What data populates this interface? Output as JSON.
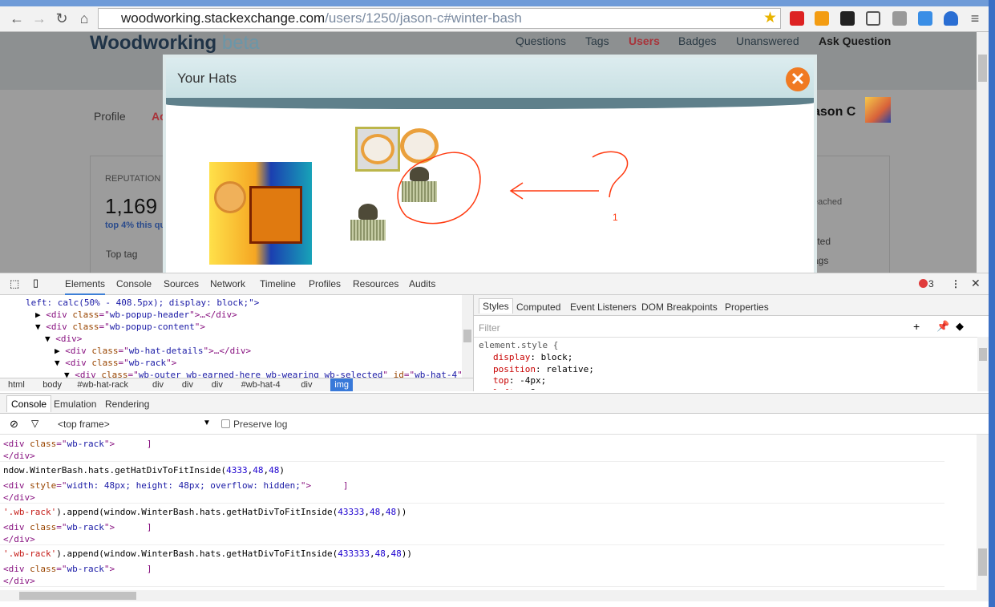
{
  "browser": {
    "url_host": "woodworking.stackexchange.com",
    "url_path": "/users/1250/jason-c#winter-bash"
  },
  "site": {
    "name": "Woodworking",
    "beta": "beta",
    "nav": [
      "Questions",
      "Tags",
      "Users",
      "Badges",
      "Unanswered",
      "Ask Question"
    ],
    "active_nav": "Users",
    "accent": "#c0392b"
  },
  "profile": {
    "tabs": [
      "Profile",
      "Ac"
    ],
    "username": "ason C",
    "reputation_label": "REPUTATION",
    "reputation": "1,169",
    "rank": "top 4% this qu",
    "top_tag": "Top tag",
    "side": [
      "eached",
      "lited",
      "ags"
    ]
  },
  "modal": {
    "title": "Your Hats",
    "close": "✕",
    "annotation_mark": "1"
  },
  "devtools": {
    "tabs": [
      "Elements",
      "Console",
      "Sources",
      "Network",
      "Timeline",
      "Profiles",
      "Resources",
      "Audits"
    ],
    "error_count": "3",
    "elements": [
      [
        [
          "left: calc(50% - 408.5px); display: block;\">",
          "val"
        ]
      ],
      [
        [
          "▶ ",
          "x"
        ],
        [
          "<div ",
          "tag"
        ],
        [
          "class",
          "attr"
        ],
        [
          "=\"",
          "tag"
        ],
        [
          "wb-popup-header",
          "val"
        ],
        [
          "\">…</div>",
          "tag"
        ]
      ],
      [
        [
          "▼ ",
          "x"
        ],
        [
          "<div ",
          "tag"
        ],
        [
          "class",
          "attr"
        ],
        [
          "=\"",
          "tag"
        ],
        [
          "wb-popup-content",
          "val"
        ],
        [
          "\">",
          "tag"
        ]
      ],
      [
        [
          "▼ ",
          "x"
        ],
        [
          "<div>",
          "tag"
        ]
      ],
      [
        [
          "▶ ",
          "x"
        ],
        [
          "<div ",
          "tag"
        ],
        [
          "class",
          "attr"
        ],
        [
          "=\"",
          "tag"
        ],
        [
          "wb-hat-details",
          "val"
        ],
        [
          "\">…</div>",
          "tag"
        ]
      ],
      [
        [
          "▼ ",
          "x"
        ],
        [
          "<div ",
          "tag"
        ],
        [
          "class",
          "attr"
        ],
        [
          "=\"",
          "tag"
        ],
        [
          "wb-rack",
          "val"
        ],
        [
          "\">",
          "tag"
        ]
      ],
      [
        [
          "▼ ",
          "x"
        ],
        [
          "<div ",
          "tag"
        ],
        [
          "class",
          "attr"
        ],
        [
          "=\"",
          "tag"
        ],
        [
          "wb-outer wb-earned-here wb-wearing wb-selected",
          "val"
        ],
        [
          "\" ",
          "tag"
        ],
        [
          "id",
          "attr"
        ],
        [
          "=\"",
          "tag"
        ],
        [
          "wb-hat-4",
          "val"
        ],
        [
          "\"",
          "tag"
        ]
      ]
    ],
    "breadcrumbs": [
      "html",
      "body",
      "#wb-hat-rack",
      "div",
      "div",
      "div",
      "#wb-hat-4",
      "div",
      "img"
    ],
    "styles_tabs": [
      "Styles",
      "Computed",
      "Event Listeners",
      "DOM Breakpoints",
      "Properties"
    ],
    "filter_placeholder": "Filter",
    "styles": {
      "selector": "element.style {",
      "rules": [
        [
          "display",
          "block;"
        ],
        [
          "position",
          "relative;"
        ],
        [
          "top",
          "-4px;"
        ],
        [
          "left",
          "-8px;"
        ]
      ]
    },
    "drawer_tabs": [
      "Console",
      "Emulation",
      "Rendering"
    ],
    "frame": "<top frame>",
    "preserve_log": "Preserve log",
    "console": [
      [
        [
          "<div ",
          "tag"
        ],
        [
          "class",
          "attr"
        ],
        [
          "=\"",
          "tag"
        ],
        [
          "wb-rack",
          "val"
        ],
        [
          "\">      ]",
          "tag"
        ]
      ],
      [
        [
          "</div>",
          "tag"
        ]
      ],
      [
        [
          "ndow.WinterBash.hats.getHatDivToFitInside(",
          "x"
        ],
        [
          "4333",
          "num"
        ],
        [
          ",",
          "x"
        ],
        [
          "48",
          "num"
        ],
        [
          ",",
          "x"
        ],
        [
          "48",
          "num"
        ],
        [
          ")",
          "x"
        ]
      ],
      [
        [
          "<div ",
          "tag"
        ],
        [
          "style",
          "attr"
        ],
        [
          "=\"",
          "tag"
        ],
        [
          "width: 48px; height: 48px; overflow: hidden;",
          "val"
        ],
        [
          "\">      ]",
          "tag"
        ]
      ],
      [
        [
          "</div>",
          "tag"
        ]
      ],
      [
        [
          "'.wb-rack'",
          "str"
        ],
        [
          ").append(window.WinterBash.hats.getHatDivToFitInside(",
          "x"
        ],
        [
          "43333",
          "num"
        ],
        [
          ",",
          "x"
        ],
        [
          "48",
          "num"
        ],
        [
          ",",
          "x"
        ],
        [
          "48",
          "num"
        ],
        [
          "))",
          "x"
        ]
      ],
      [
        [
          "<div ",
          "tag"
        ],
        [
          "class",
          "attr"
        ],
        [
          "=\"",
          "tag"
        ],
        [
          "wb-rack",
          "val"
        ],
        [
          "\">      ]",
          "tag"
        ]
      ],
      [
        [
          "</div>",
          "tag"
        ]
      ],
      [
        [
          "'.wb-rack'",
          "str"
        ],
        [
          ").append(window.WinterBash.hats.getHatDivToFitInside(",
          "x"
        ],
        [
          "433333",
          "num"
        ],
        [
          ",",
          "x"
        ],
        [
          "48",
          "num"
        ],
        [
          ",",
          "x"
        ],
        [
          "48",
          "num"
        ],
        [
          "))",
          "x"
        ]
      ],
      [
        [
          "<div ",
          "tag"
        ],
        [
          "class",
          "attr"
        ],
        [
          "=\"",
          "tag"
        ],
        [
          "wb-rack",
          "val"
        ],
        [
          "\">      ]",
          "tag"
        ]
      ],
      [
        [
          "</div>",
          "tag"
        ]
      ]
    ]
  }
}
